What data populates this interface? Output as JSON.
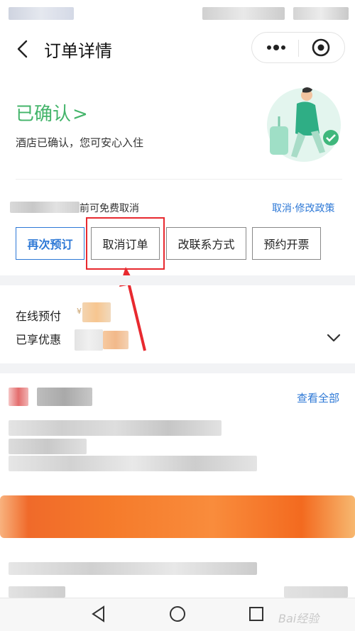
{
  "header": {
    "title": "订单详情"
  },
  "status": {
    "title": "已确认",
    "chevron": ">",
    "description": "酒店已确认，您可安心入住"
  },
  "cancel": {
    "free_cancel_text": "前可免费取消",
    "policy_link": "取消·修改政策"
  },
  "actions": {
    "rebook": "再次预订",
    "cancel_order": "取消订单",
    "change_contact": "改联系方式",
    "invoice": "预约开票"
  },
  "payment": {
    "online_pay_label": "在线预付",
    "currency_symbol": "¥",
    "discount_label": "已享优惠"
  },
  "details": {
    "view_all": "查看全部"
  },
  "watermark": {
    "text": "Bai经验"
  },
  "colors": {
    "confirmed_green": "#43b46a",
    "link_blue": "#2d78d6",
    "highlight_red": "#e8292f",
    "banner_orange": "#f57a2a"
  },
  "icons": [
    "back-icon",
    "more-icon",
    "target-icon",
    "chevron-down-icon",
    "nav-back-icon",
    "nav-home-icon",
    "nav-recent-icon"
  ]
}
